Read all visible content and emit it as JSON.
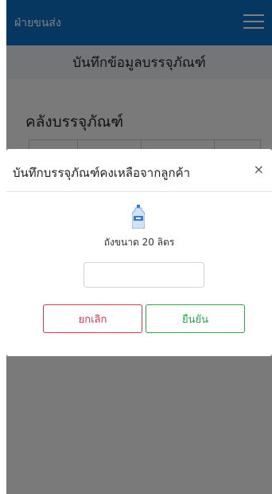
{
  "topbar": {
    "brand": "ฝ่ายขนส่ง",
    "menu_icon": "hamburger-icon",
    "color": "#0d6ec3"
  },
  "page": {
    "title": "บันทึกข้อมูลบรรจุภัณฑ์",
    "section_title": "คลังบรรจุภัณฑ์"
  },
  "modal": {
    "title": "บันทึกบรรจุภัณฑ์คงเหลือจากลูกค้า",
    "close_label": "×",
    "product_icon": "water-bottle-icon",
    "product_label": "ถังขนาด 20 ลิตร",
    "quantity_value": "",
    "cancel_label": "ยกเลิก",
    "confirm_label": "ยืนยัน",
    "cancel_color": "#dc3545",
    "confirm_color": "#28a745"
  }
}
